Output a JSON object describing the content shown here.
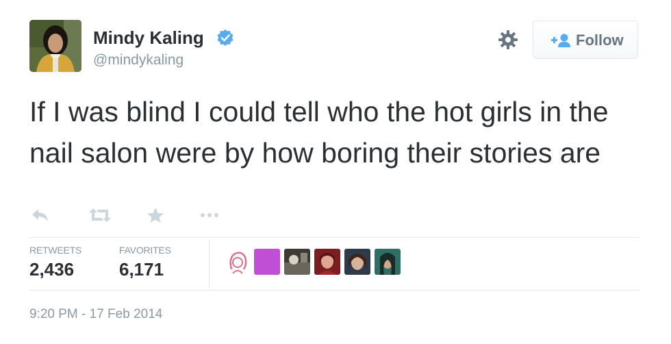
{
  "user": {
    "name": "Mindy Kaling",
    "handle": "@mindykaling",
    "verified": true,
    "avatar_icon": "user-avatar-photo"
  },
  "header": {
    "settings_icon": "gear-icon",
    "follow_label": "Follow",
    "follow_icon": "add-user-icon"
  },
  "tweet": {
    "text": "If I was blind I could tell who the hot girls in the nail salon were by how boring their stories are"
  },
  "actions": {
    "reply_icon": "reply-icon",
    "retweet_icon": "retweet-icon",
    "favorite_icon": "star-icon",
    "more_icon": "more-dots-icon"
  },
  "stats": {
    "retweets_label": "RETWEETS",
    "retweets_value": "2,436",
    "favorites_label": "FAVORITES",
    "favorites_value": "6,171"
  },
  "favoriters_count_shown": 6,
  "timestamp": "9:20 PM - 17 Feb 2014",
  "colors": {
    "verified_blue": "#55acee",
    "text": "#292f33",
    "muted": "#8899a6",
    "follow_accent": "#55acee"
  }
}
